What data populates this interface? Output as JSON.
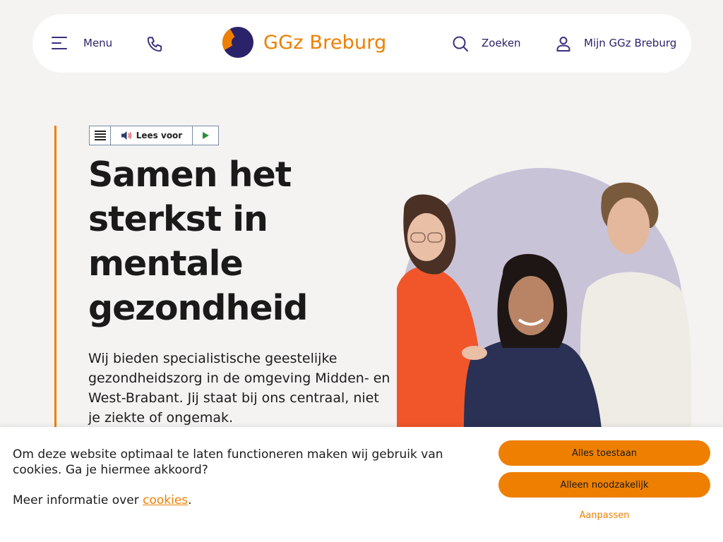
{
  "header": {
    "menu_label": "Menu",
    "logo_text": "GGz Breburg",
    "search_label": "Zoeken",
    "account_label": "Mijn GGz Breburg"
  },
  "readspeaker": {
    "label": "Lees voor"
  },
  "hero": {
    "title": "Samen het sterkst in mentale gezondheid",
    "intro": "Wij bieden specialistische geestelijke gezondheidszorg in de omgeving Midden- en West-Brabant. Jij staat bij ons centraal, niet je ziekte of ongemak."
  },
  "cookie_banner": {
    "message": "Om deze website optimaal te laten functioneren maken wij gebruik van cookies. Ga je hiermee akkoord?",
    "more_prefix": "Meer informatie over ",
    "more_link": "cookies",
    "more_suffix": ".",
    "accept_all": "Alles toestaan",
    "only_necessary": "Alleen noodzakelijk",
    "customize": "Aanpassen"
  },
  "colors": {
    "brand_orange": "#ee7f00",
    "brand_purple": "#2b2369",
    "background": "#f4f3f2",
    "circle_lilac": "#c9c3d8"
  },
  "icons": [
    "hamburger-icon",
    "phone-icon",
    "logo-mark",
    "search-icon",
    "user-icon",
    "speaker-icon",
    "play-icon"
  ]
}
